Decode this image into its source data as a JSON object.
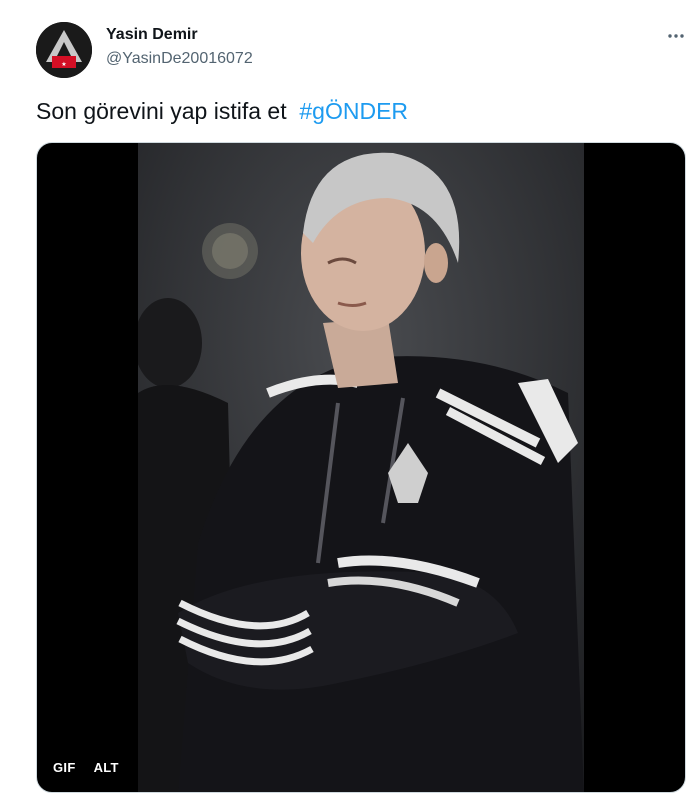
{
  "tweet": {
    "author": {
      "name": "Yasin Demir",
      "handle": "@YasinDe20016072"
    },
    "text": "Son görevini yap istifa et  ",
    "hashtag": "#gÖNDER",
    "media": {
      "type_badge": "GIF",
      "alt_badge": "ALT"
    }
  },
  "icons": {
    "more": "more-horizontal-icon",
    "avatar": "club-crest-avatar"
  },
  "colors": {
    "hashtag": "#1d9bf0",
    "secondary_text": "#536471",
    "media_bg": "#000000"
  }
}
